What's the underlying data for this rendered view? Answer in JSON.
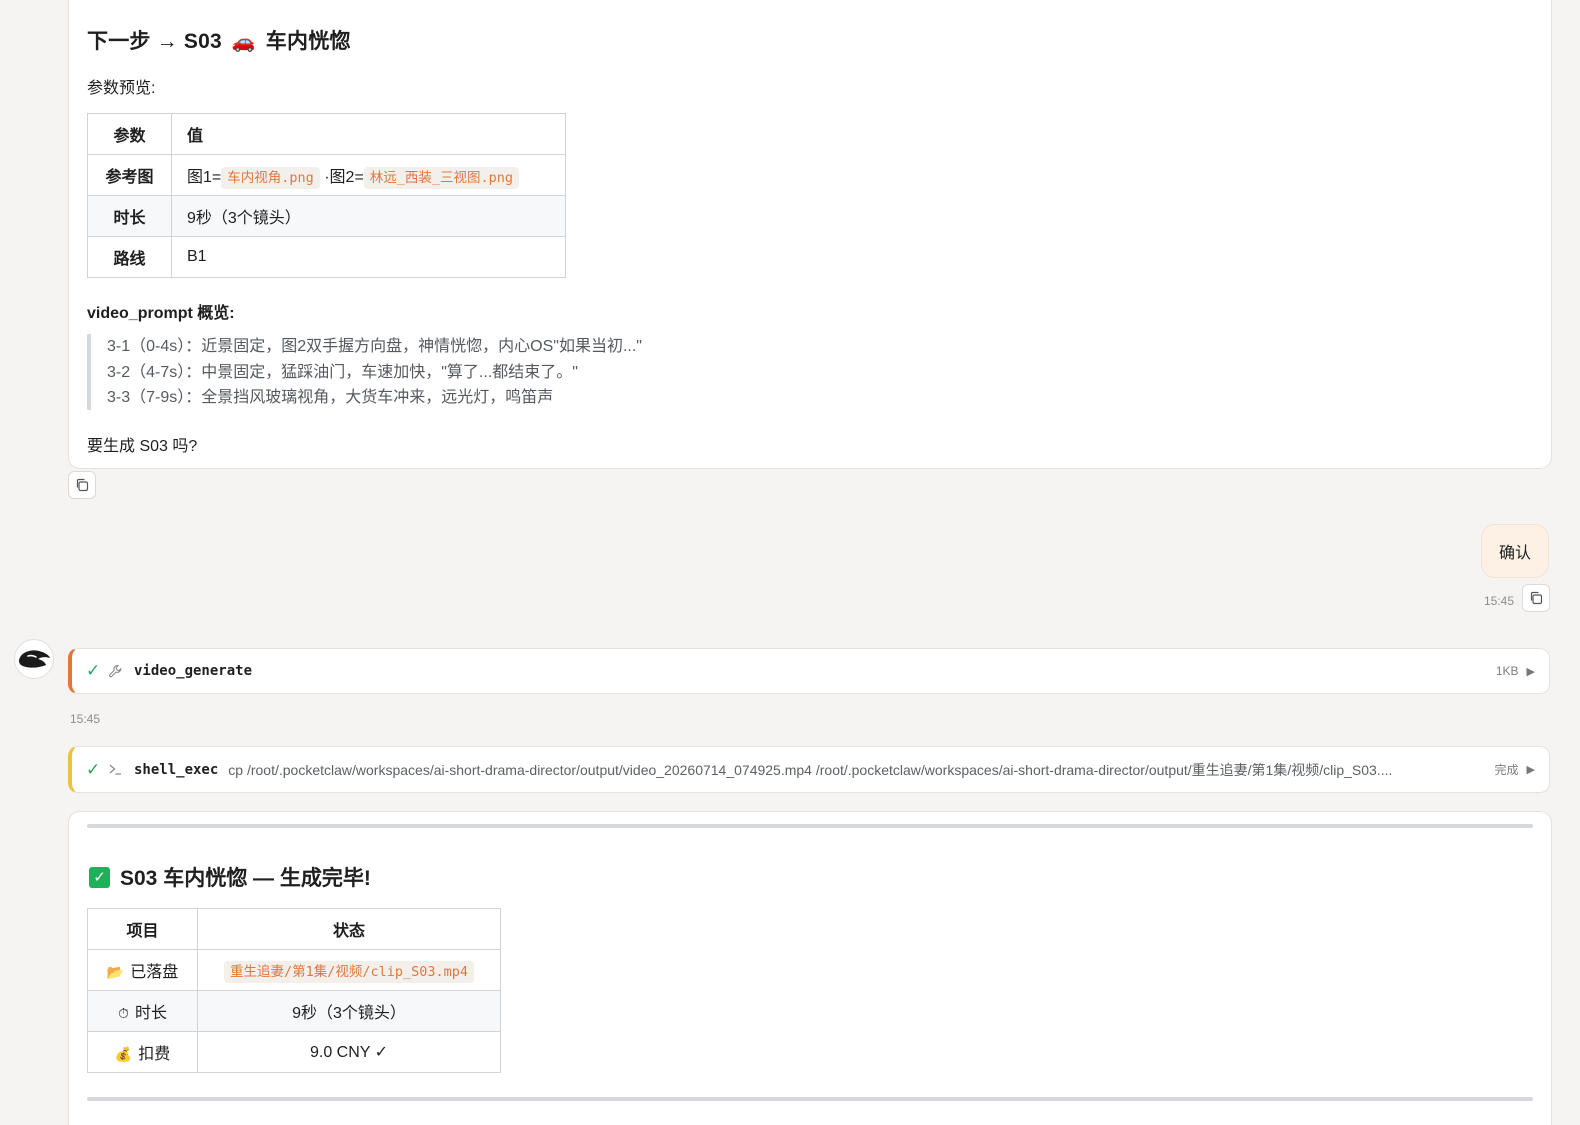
{
  "message": {
    "heading_prefix": "下一步 → S03",
    "heading_icon": "🚗",
    "heading_suffix": "车内恍惚",
    "params_label": "参数预览:",
    "table": {
      "header": [
        "参数",
        "值"
      ],
      "rows": {
        "ref": {
          "key": "参考图",
          "p1": "图1=",
          "file1": "车内视角.png",
          "p2": "·图2=",
          "file2": "林远_西装_三视图.png"
        },
        "duration": {
          "key": "时长",
          "value": "9秒（3个镜头）"
        },
        "route": {
          "key": "路线",
          "value": "B1"
        }
      }
    },
    "video_prompt_title": "video_prompt 概览:",
    "shots": [
      "3-1（0-4s）：近景固定，图2双手握方向盘，神情恍惚，内心OS\"如果当初...\"",
      "3-2（4-7s）：中景固定，猛踩油门，车速加快，\"算了...都结束了。\"",
      "3-3（7-9s）：全景挡风玻璃视角，大货车冲来，远光灯，鸣笛声"
    ],
    "question": "要生成 S03 吗?"
  },
  "user_message": {
    "text": "确认",
    "time": "15:45"
  },
  "tool_calls": [
    {
      "name": "video_generate",
      "size": "1KB",
      "time": "15:45"
    },
    {
      "name": "shell_exec",
      "command": "cp /root/.pocketclaw/workspaces/ai-short-drama-director/output/video_20260714_074925.mp4 /root/.pocketclaw/workspaces/ai-short-drama-director/output/重生追妻/第1集/视频/clip_S03....",
      "status": "完成"
    }
  ],
  "result": {
    "title": "S03 车内恍惚 — 生成完毕!",
    "table": {
      "header": [
        "项目",
        "状态"
      ],
      "rows": [
        {
          "icon": "📂",
          "key": "已落盘",
          "value": "重生追妻/第1集/视频/clip_S03.mp4"
        },
        {
          "icon": "⏱",
          "key": "时长",
          "value": "9秒（3个镜头）"
        },
        {
          "icon": "💰",
          "key": "扣费",
          "value": "9.0 CNY ✓"
        }
      ]
    }
  },
  "colors": {
    "accent_orange": "#e0783c",
    "accent_yellow": "#f0c040",
    "success_green": "#2aa65a",
    "user_bubble": "#fdf1e6"
  }
}
